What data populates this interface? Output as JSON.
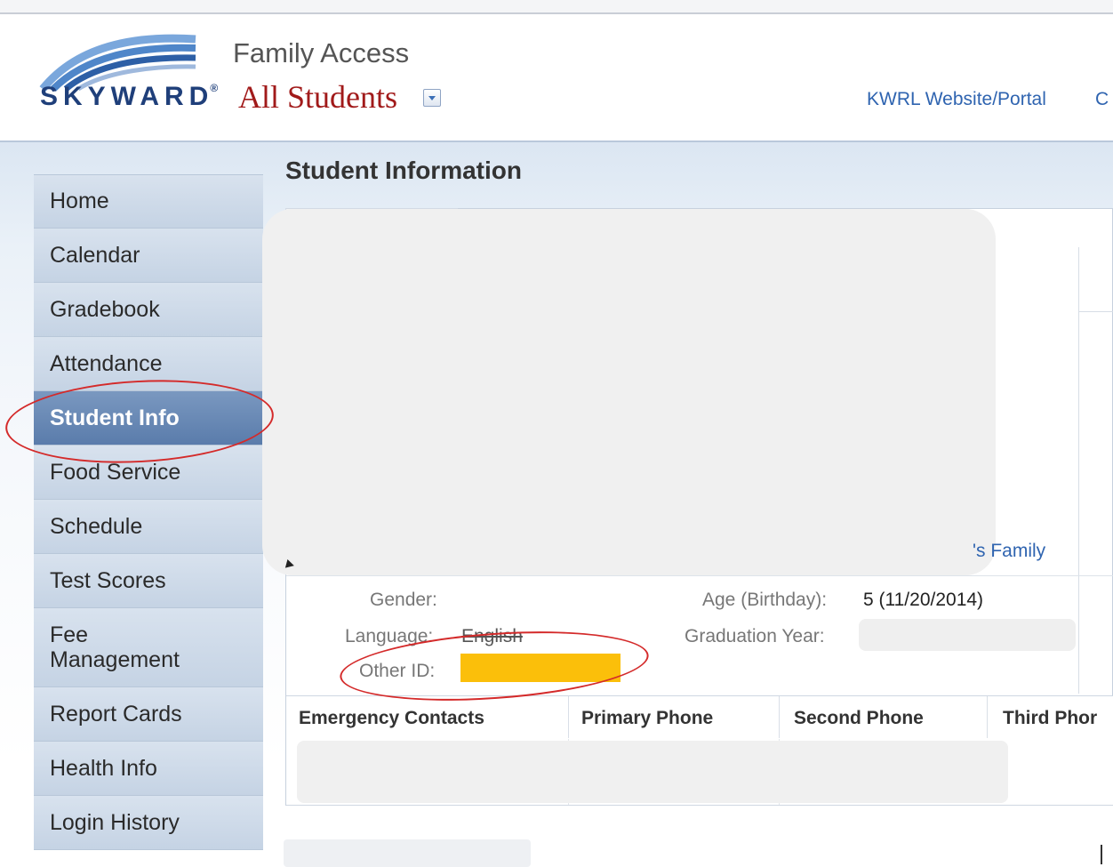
{
  "header": {
    "logo_text": "SKYWARD",
    "logo_reg": "®",
    "app_name": "Family Access",
    "student_selector": "All Students",
    "portal_link": "KWRL Website/Portal",
    "cut_link": "C"
  },
  "sidebar": {
    "items": [
      {
        "label": "Home"
      },
      {
        "label": "Calendar"
      },
      {
        "label": "Gradebook"
      },
      {
        "label": "Attendance"
      },
      {
        "label": "Student Info",
        "active": true
      },
      {
        "label": "Food Service"
      },
      {
        "label": "Schedule"
      },
      {
        "label": "Test Scores"
      },
      {
        "label": "Fee Management"
      },
      {
        "label": "Report Cards"
      },
      {
        "label": "Health Info"
      },
      {
        "label": "Login History"
      }
    ]
  },
  "main": {
    "title": "Student Information",
    "family_link": "'s Family",
    "fields": {
      "gender_label": "Gender:",
      "age_label": "Age (Birthday):",
      "age_value": "5 (11/20/2014)",
      "language_label": "Language:",
      "language_value": "English",
      "graduation_label": "Graduation Year:",
      "other_id_label": "Other ID:"
    },
    "table": {
      "columns": [
        "Emergency Contacts",
        "Primary Phone",
        "Second Phone",
        "Third Phor"
      ]
    }
  },
  "colors": {
    "accent": "#2f64b0",
    "student_selector": "#a11a1a",
    "nav_active": "#5a7cab",
    "annotation": "#d42a2a",
    "highlight": "#fbbf0a"
  }
}
